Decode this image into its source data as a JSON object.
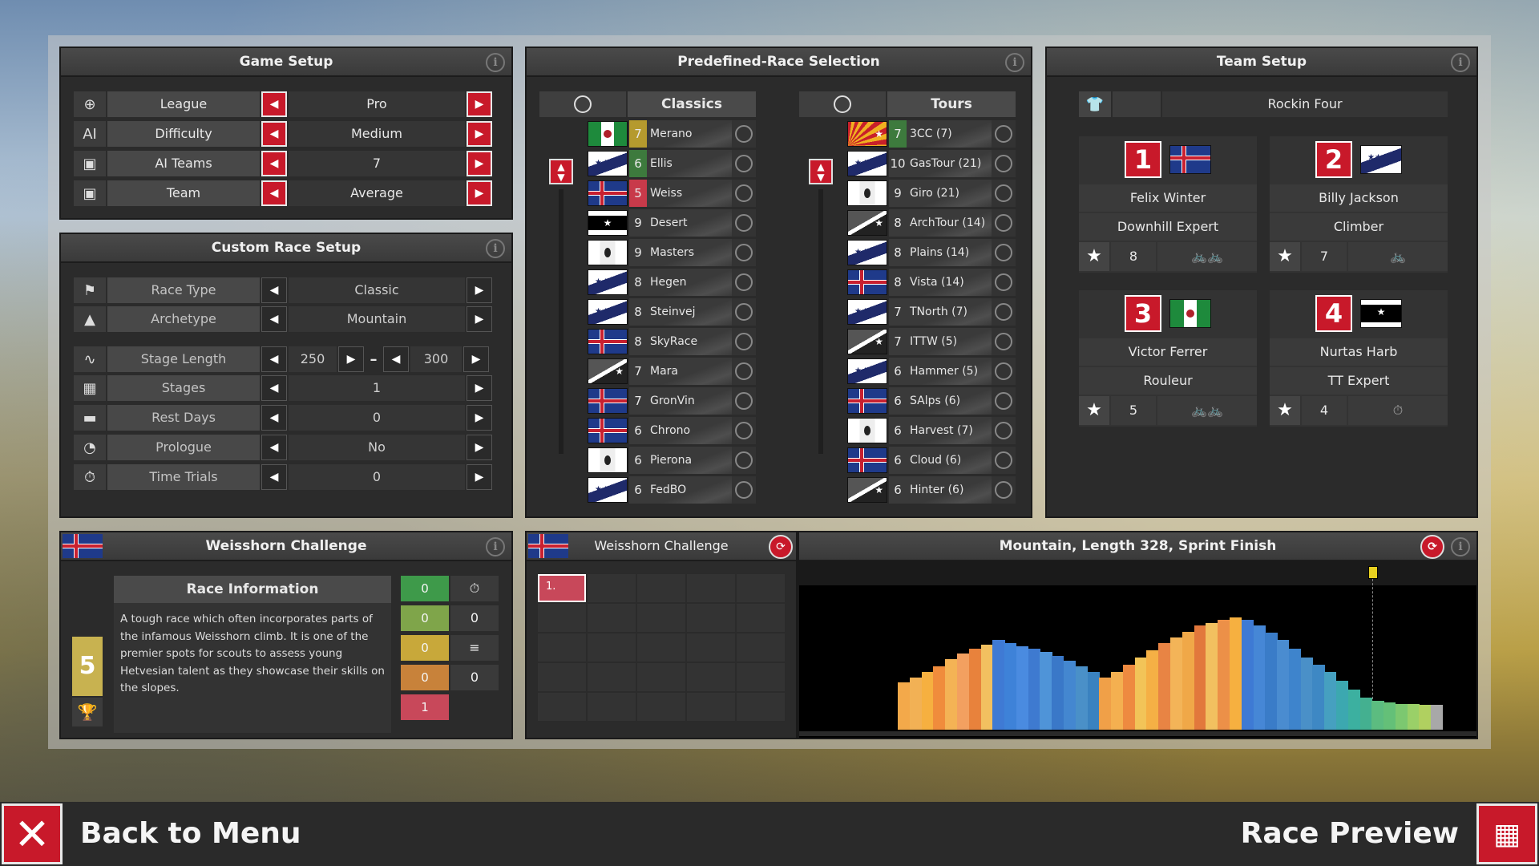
{
  "game_setup": {
    "title": "Game Setup",
    "rows": [
      {
        "label": "League",
        "value": "Pro"
      },
      {
        "label": "Difficulty",
        "value": "Medium"
      },
      {
        "label": "AI Teams",
        "value": "7"
      },
      {
        "label": "Team",
        "value": "Average"
      }
    ]
  },
  "custom_race": {
    "title": "Custom Race Setup",
    "race_type": {
      "label": "Race Type",
      "value": "Classic"
    },
    "archetype": {
      "label": "Archetype",
      "value": "Mountain"
    },
    "stage_length": {
      "label": "Stage Length",
      "min": "250",
      "sep": "–",
      "max": "300"
    },
    "stages": {
      "label": "Stages",
      "value": "1"
    },
    "rest_days": {
      "label": "Rest Days",
      "value": "0"
    },
    "prologue": {
      "label": "Prologue",
      "value": "No"
    },
    "time_trials": {
      "label": "Time Trials",
      "value": "0"
    }
  },
  "predefined": {
    "title": "Predefined-Race Selection",
    "classics": {
      "header": "Classics",
      "rows": [
        {
          "n": "7",
          "name": "Merano",
          "flag": "mexico",
          "color": "#b59a2e"
        },
        {
          "n": "6",
          "name": "Ellis",
          "flag": "stars",
          "color": "#3d7a3d"
        },
        {
          "n": "5",
          "name": "Weiss",
          "flag": "cross",
          "color": "#c83a4a"
        },
        {
          "n": "9",
          "name": "Desert",
          "flag": "blackstar",
          "color": "#3a3a3a"
        },
        {
          "n": "9",
          "name": "Masters",
          "flag": "dot",
          "color": "#3a3a3a"
        },
        {
          "n": "8",
          "name": "Hegen",
          "flag": "stars",
          "color": "#3a3a3a"
        },
        {
          "n": "8",
          "name": "Steinvej",
          "flag": "stars",
          "color": "#3a3a3a"
        },
        {
          "n": "8",
          "name": "SkyRace",
          "flag": "cross",
          "color": "#3a3a3a"
        },
        {
          "n": "7",
          "name": "Mara",
          "flag": "stripestar",
          "color": "#3a3a3a"
        },
        {
          "n": "7",
          "name": "GronVin",
          "flag": "cross",
          "color": "#3a3a3a"
        },
        {
          "n": "6",
          "name": "Chrono",
          "flag": "cross",
          "color": "#3a3a3a"
        },
        {
          "n": "6",
          "name": "Pierona",
          "flag": "dot",
          "color": "#3a3a3a"
        },
        {
          "n": "6",
          "name": "FedBO",
          "flag": "stars",
          "color": "#3a3a3a"
        }
      ]
    },
    "tours": {
      "header": "Tours",
      "rows": [
        {
          "n": "7",
          "name": "3CC (7)",
          "flag": "sun",
          "color": "#3d7a3d"
        },
        {
          "n": "10",
          "name": "GasTour (21)",
          "flag": "stars",
          "color": "#3a3a3a"
        },
        {
          "n": "9",
          "name": "Giro (21)",
          "flag": "dot",
          "color": "#3a3a3a"
        },
        {
          "n": "8",
          "name": "ArchTour (14)",
          "flag": "stripestar",
          "color": "#3a3a3a"
        },
        {
          "n": "8",
          "name": "Plains (14)",
          "flag": "stars",
          "color": "#3a3a3a"
        },
        {
          "n": "8",
          "name": "Vista (14)",
          "flag": "cross",
          "color": "#3a3a3a"
        },
        {
          "n": "7",
          "name": "TNorth (7)",
          "flag": "stars",
          "color": "#3a3a3a"
        },
        {
          "n": "7",
          "name": "ITTW (5)",
          "flag": "stripestar",
          "color": "#3a3a3a"
        },
        {
          "n": "6",
          "name": "Hammer (5)",
          "flag": "stars",
          "color": "#3a3a3a"
        },
        {
          "n": "6",
          "name": "SAlps (6)",
          "flag": "cross",
          "color": "#3a3a3a"
        },
        {
          "n": "6",
          "name": "Harvest (7)",
          "flag": "dot",
          "color": "#3a3a3a"
        },
        {
          "n": "6",
          "name": "Cloud (6)",
          "flag": "cross",
          "color": "#3a3a3a"
        },
        {
          "n": "6",
          "name": "Hinter (6)",
          "flag": "stripestar",
          "color": "#3a3a3a"
        }
      ]
    }
  },
  "team_setup": {
    "title": "Team Setup",
    "team_name": "Rockin Four",
    "riders": [
      {
        "num": "1",
        "name": "Felix Winter",
        "role": "Downhill Expert",
        "rating": "8",
        "flag": "cross",
        "icons": "🚲🚲"
      },
      {
        "num": "2",
        "name": "Billy Jackson",
        "role": "Climber",
        "rating": "7",
        "flag": "stars",
        "icons": "🚲"
      },
      {
        "num": "3",
        "name": "Victor Ferrer",
        "role": "Rouleur",
        "rating": "5",
        "flag": "mexico",
        "icons": "🚲🚲"
      },
      {
        "num": "4",
        "name": "Nurtas Harb",
        "role": "TT Expert",
        "rating": "4",
        "flag": "blackstar",
        "icons": "⏱"
      }
    ]
  },
  "race_info": {
    "title": "Weisshorn Challenge",
    "subheader": "Race Information",
    "description": "A tough race which often incorporates parts of the infamous Weisshorn climb. It is one of the premier spots for scouts to assess young Hetvesian talent as they showcase their skills on the slopes.",
    "level": "5",
    "stats": [
      {
        "value": "0",
        "color": "#3e9a4a",
        "right": "⏱"
      },
      {
        "value": "0",
        "color": "#7fa54a",
        "right": "0"
      },
      {
        "value": "0",
        "color": "#c8a83a",
        "right": "≡"
      },
      {
        "value": "0",
        "color": "#c8823a",
        "right": "0"
      },
      {
        "value": "1",
        "color": "#c8485a",
        "right": ""
      }
    ]
  },
  "stage_grid": {
    "title": "Weisshorn Challenge",
    "selected": "1."
  },
  "profile": {
    "title": "Mountain, Length 328, Sprint Finish",
    "segments": [
      {
        "h": 0.33,
        "c": "#f3a94a"
      },
      {
        "h": 0.36,
        "c": "#f2b155"
      },
      {
        "h": 0.4,
        "c": "#f6b040"
      },
      {
        "h": 0.44,
        "c": "#f08c3c"
      },
      {
        "h": 0.49,
        "c": "#f4b355"
      },
      {
        "h": 0.53,
        "c": "#f3a060"
      },
      {
        "h": 0.56,
        "c": "#e8823c"
      },
      {
        "h": 0.59,
        "c": "#f2c060"
      },
      {
        "h": 0.62,
        "c": "#3f7ad4"
      },
      {
        "h": 0.6,
        "c": "#3e82d8"
      },
      {
        "h": 0.58,
        "c": "#4a8be0"
      },
      {
        "h": 0.56,
        "c": "#3e7ad0"
      },
      {
        "h": 0.54,
        "c": "#4f94d8"
      },
      {
        "h": 0.51,
        "c": "#3a78c8"
      },
      {
        "h": 0.48,
        "c": "#4487d0"
      },
      {
        "h": 0.44,
        "c": "#4a90c8"
      },
      {
        "h": 0.4,
        "c": "#3a82c0"
      },
      {
        "h": 0.36,
        "c": "#f0a048"
      },
      {
        "h": 0.4,
        "c": "#f4b050"
      },
      {
        "h": 0.45,
        "c": "#ee8a40"
      },
      {
        "h": 0.5,
        "c": "#f2c458"
      },
      {
        "h": 0.55,
        "c": "#f5b045"
      },
      {
        "h": 0.6,
        "c": "#e88444"
      },
      {
        "h": 0.64,
        "c": "#f3b458"
      },
      {
        "h": 0.68,
        "c": "#f0a848"
      },
      {
        "h": 0.72,
        "c": "#e2783c"
      },
      {
        "h": 0.74,
        "c": "#f2c060"
      },
      {
        "h": 0.76,
        "c": "#ec9048"
      },
      {
        "h": 0.78,
        "c": "#f6b040"
      },
      {
        "h": 0.76,
        "c": "#3e7ad4"
      },
      {
        "h": 0.72,
        "c": "#4687d6"
      },
      {
        "h": 0.67,
        "c": "#3a7cc8"
      },
      {
        "h": 0.62,
        "c": "#4a8cd0"
      },
      {
        "h": 0.56,
        "c": "#3e84cc"
      },
      {
        "h": 0.5,
        "c": "#4a90c8"
      },
      {
        "h": 0.45,
        "c": "#3e88c4"
      },
      {
        "h": 0.4,
        "c": "#46a0c0"
      },
      {
        "h": 0.34,
        "c": "#3ca8b0"
      },
      {
        "h": 0.28,
        "c": "#3cb0a0"
      },
      {
        "h": 0.22,
        "c": "#44b090"
      },
      {
        "h": 0.2,
        "c": "#5cbc80"
      },
      {
        "h": 0.19,
        "c": "#64c078"
      },
      {
        "h": 0.18,
        "c": "#7cc870"
      },
      {
        "h": 0.18,
        "c": "#9ad068"
      },
      {
        "h": 0.17,
        "c": "#b0d060"
      },
      {
        "h": 0.17,
        "c": "#a8a8a8"
      }
    ]
  },
  "footer": {
    "back_label": "Back to Menu",
    "preview_label": "Race Preview"
  }
}
